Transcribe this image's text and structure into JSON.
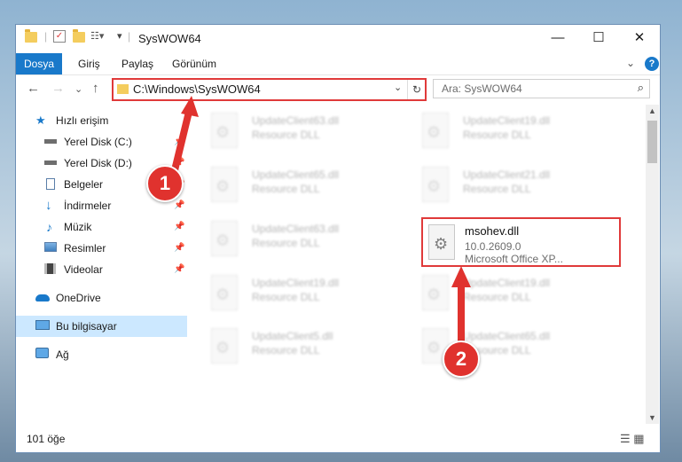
{
  "window": {
    "title": "SysWOW64"
  },
  "ribbon": {
    "tabs": [
      "Dosya",
      "Giriş",
      "Paylaş",
      "Görünüm"
    ],
    "help": "?"
  },
  "window_controls": {
    "minimize": "—",
    "maximize": "☐",
    "close": "✕"
  },
  "address": {
    "path": "C:\\Windows\\SysWOW64",
    "refresh": "↻",
    "dropdown": "⌄"
  },
  "search": {
    "placeholder": "Ara: SysWOW64",
    "icon": "⌕"
  },
  "nav": {
    "back": "←",
    "forward": "→",
    "recent": "⌄",
    "up": "↑",
    "items": [
      {
        "label": "Hızlı erişim",
        "icon": "star-icon"
      },
      {
        "label": "Yerel Disk (C:)",
        "icon": "drive-icon",
        "pinned": true
      },
      {
        "label": "Yerel Disk (D:)",
        "icon": "drive-icon",
        "pinned": true
      },
      {
        "label": "Belgeler",
        "icon": "documents-icon",
        "pinned": true
      },
      {
        "label": "İndirmeler",
        "icon": "download-icon",
        "pinned": true
      },
      {
        "label": "Müzik",
        "icon": "music-icon",
        "pinned": true
      },
      {
        "label": "Resimler",
        "icon": "pictures-icon",
        "pinned": true
      },
      {
        "label": "Videolar",
        "icon": "videos-icon",
        "pinned": true
      },
      {
        "label": "OneDrive",
        "icon": "cloud-icon"
      },
      {
        "label": "Bu bilgisayar",
        "icon": "computer-icon",
        "selected": true
      },
      {
        "label": "Ağ",
        "icon": "network-icon"
      }
    ]
  },
  "files": [
    {
      "name": "UpdateClient63.dll",
      "desc": "Resource DLL"
    },
    {
      "name": "UpdateClient19.dll",
      "desc": "Resource DLL"
    },
    {
      "name": "UpdateClient65.dll",
      "desc": "Resource DLL"
    },
    {
      "name": "UpdateClient21.dll",
      "desc": "Resource DLL"
    },
    {
      "name": "UpdateClient63.dll",
      "desc": "Resource DLL"
    },
    {
      "name": "UpdateClient19.dll",
      "desc": "Resource DLL"
    },
    {
      "name": "UpdateClient19.dll",
      "desc": "Resource DLL"
    },
    {
      "name": "UpdateClient5.dll",
      "desc": "Resource DLL"
    },
    {
      "name": "UpdateClient65.dll",
      "desc": "Resource DLL"
    }
  ],
  "highlighted_file": {
    "name": "msohev.dll",
    "version": "10.0.2609.0",
    "desc": "Microsoft Office XP..."
  },
  "status": {
    "count": "101 öğe"
  },
  "annotations": {
    "step1": "1",
    "step2": "2",
    "color": "#e0322e"
  },
  "colors": {
    "accent": "#1979ca",
    "selected": "#cce8ff",
    "highlight": "#e03a3a"
  }
}
